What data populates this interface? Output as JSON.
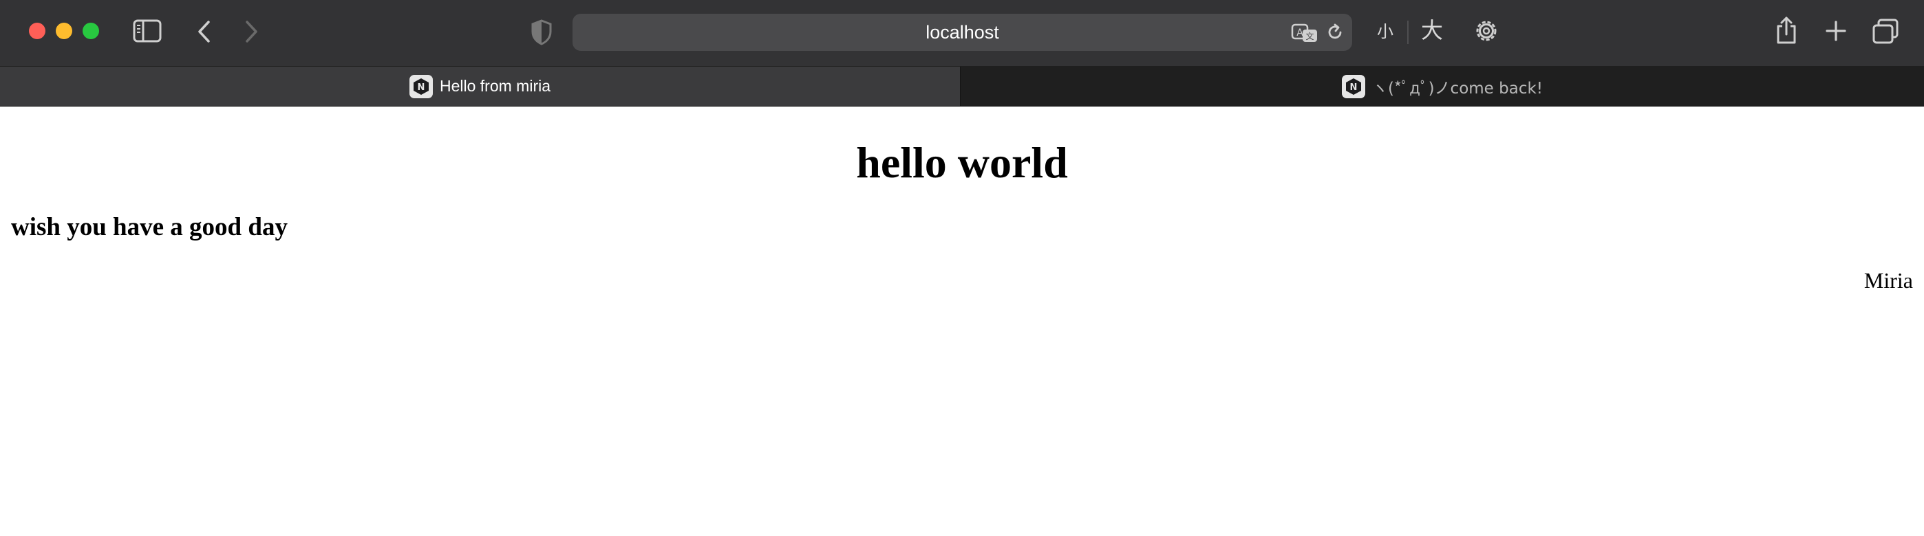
{
  "browser": {
    "address": "localhost",
    "font_size_small_label": "小",
    "font_size_large_label": "大",
    "colors": {
      "toolbar_bg": "#333335",
      "tab_active_bg": "#3b3b3d",
      "tab_inactive_bg": "#1f1f1f",
      "traffic_red": "#ff5f57",
      "traffic_yellow": "#febc2e",
      "traffic_green": "#28c840"
    },
    "icons": [
      "sidebar-icon",
      "back-icon",
      "forward-icon",
      "privacy-shield-icon",
      "translate-icon",
      "reload-icon",
      "settings-gear-icon",
      "share-icon",
      "new-tab-icon",
      "tab-overview-icon"
    ]
  },
  "tabs": [
    {
      "title": "Hello from miria",
      "favicon_letter": "N",
      "active": true
    },
    {
      "title": "ヽ(*ﾟдﾟ)ノcome back!",
      "favicon_letter": "N",
      "active": false
    }
  ],
  "page": {
    "title": "hello world",
    "subtitle": "wish you have a good day",
    "author": "Miria"
  }
}
